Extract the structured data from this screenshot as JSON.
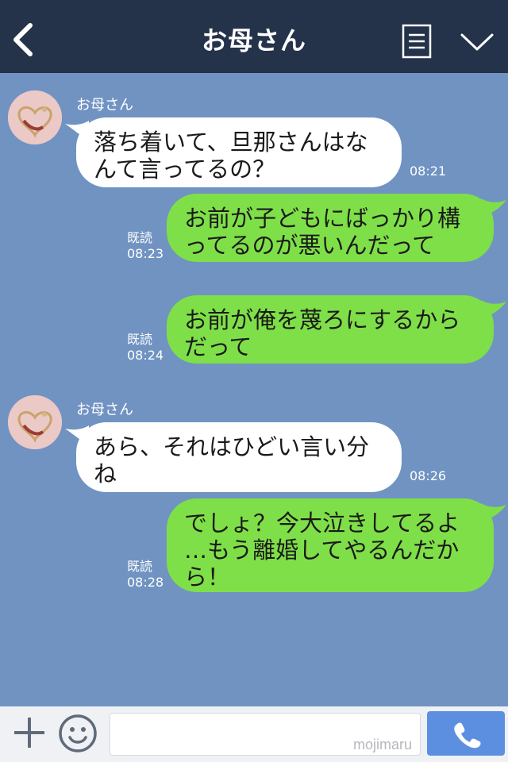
{
  "header": {
    "title": "お母さん",
    "icons": [
      "chevron-left-icon",
      "menu-list-icon",
      "chevron-down-icon"
    ]
  },
  "messages": [
    {
      "type": "received",
      "sender": "お母さん",
      "lines": [
        "落ち着いて、旦那さんはな",
        "んて言ってるの？"
      ],
      "time": "08:21"
    },
    {
      "type": "sent",
      "read": "既読",
      "lines": [
        "お前が子どもにばっかり構",
        "ってるのが悪いんだって"
      ],
      "time": "08:23"
    },
    {
      "type": "sent",
      "read": "既読",
      "lines": [
        "お前が俺を蔑ろにするから",
        "だって"
      ],
      "time": "08:24"
    },
    {
      "type": "received",
      "sender": "お母さん",
      "lines": [
        "あら、それはひどい言い分",
        "ね"
      ],
      "time": "08:26"
    },
    {
      "type": "sent",
      "read": "既読",
      "lines": [
        "でしょ？今大泣きしてるよ",
        "…もう離婚してやるんだか",
        "ら！"
      ],
      "time": "08:28"
    }
  ],
  "footer": {
    "watermark": "mojimaru",
    "icons": [
      "plus-icon",
      "emoji-icon",
      "phone-icon"
    ]
  },
  "colors": {
    "header_bg": "#24324a",
    "chat_bg": "#7093c2",
    "sent_bubble": "#7fdf48",
    "received_bubble": "#ffffff",
    "call_button": "#5c8fe0"
  }
}
